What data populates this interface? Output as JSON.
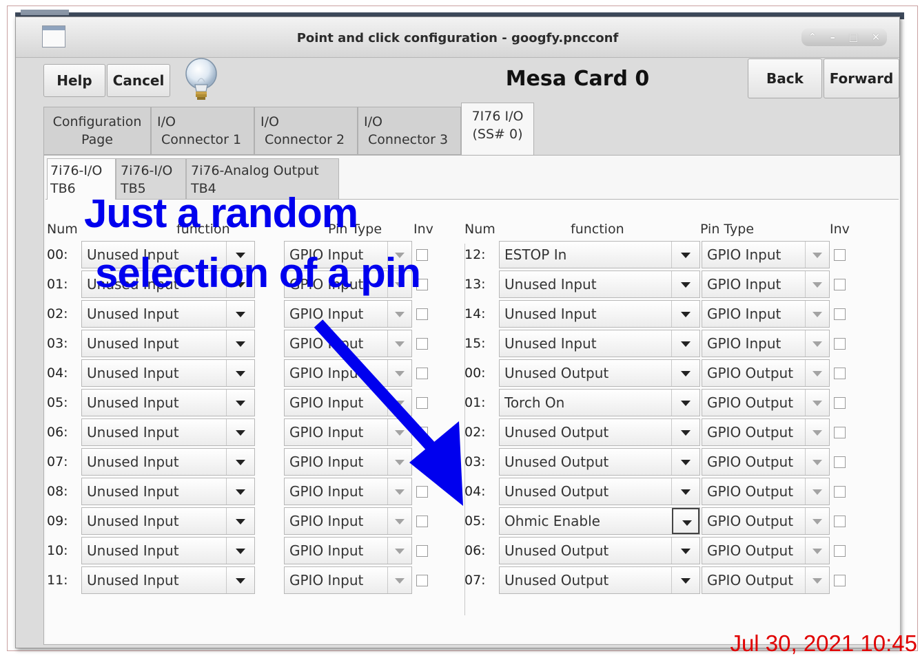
{
  "window": {
    "title": "Point and click configuration - googfy.pncconf"
  },
  "window_controls": [
    "⌃",
    "–",
    "□",
    "✕"
  ],
  "toolbar": {
    "help_label": "Help",
    "cancel_label": "Cancel",
    "back_label": "Back",
    "forward_label": "Forward",
    "heading": "Mesa Card 0"
  },
  "tabs": [
    {
      "line1": "Configuration",
      "line2": "Page"
    },
    {
      "line1": "I/O",
      "line2": "Connector 1"
    },
    {
      "line1": "I/O",
      "line2": "Connector 2"
    },
    {
      "line1": "I/O",
      "line2": "Connector 3"
    },
    {
      "line1": "7I76 I/O",
      "line2": "(SS# 0)"
    }
  ],
  "subtabs": [
    {
      "line1": "7i76-I/O",
      "line2": "TB6"
    },
    {
      "line1": "7i76-I/O",
      "line2": "TB5"
    },
    {
      "line1": "7i76-Analog Output",
      "line2": "TB4"
    }
  ],
  "headers": {
    "num": "Num",
    "function": "function",
    "pin_type": "Pin Type",
    "inv": "Inv"
  },
  "left_pins": [
    {
      "num": "00:",
      "function": "Unused Input",
      "pin_type": "GPIO Input"
    },
    {
      "num": "01:",
      "function": "Unused Input",
      "pin_type": "GPIO Input"
    },
    {
      "num": "02:",
      "function": "Unused Input",
      "pin_type": "GPIO Input"
    },
    {
      "num": "03:",
      "function": "Unused Input",
      "pin_type": "GPIO Input"
    },
    {
      "num": "04:",
      "function": "Unused Input",
      "pin_type": "GPIO Input"
    },
    {
      "num": "05:",
      "function": "Unused Input",
      "pin_type": "GPIO Input"
    },
    {
      "num": "06:",
      "function": "Unused Input",
      "pin_type": "GPIO Input"
    },
    {
      "num": "07:",
      "function": "Unused Input",
      "pin_type": "GPIO Input"
    },
    {
      "num": "08:",
      "function": "Unused Input",
      "pin_type": "GPIO Input"
    },
    {
      "num": "09:",
      "function": "Unused Input",
      "pin_type": "GPIO Input"
    },
    {
      "num": "10:",
      "function": "Unused Input",
      "pin_type": "GPIO Input"
    },
    {
      "num": "11:",
      "function": "Unused Input",
      "pin_type": "GPIO Input"
    }
  ],
  "right_pins": [
    {
      "num": "12:",
      "function": "ESTOP In",
      "pin_type": "GPIO Input"
    },
    {
      "num": "13:",
      "function": "Unused Input",
      "pin_type": "GPIO Input"
    },
    {
      "num": "14:",
      "function": "Unused Input",
      "pin_type": "GPIO Input"
    },
    {
      "num": "15:",
      "function": "Unused Input",
      "pin_type": "GPIO Input"
    },
    {
      "num": "00:",
      "function": "Unused Output",
      "pin_type": "GPIO Output"
    },
    {
      "num": "01:",
      "function": "Torch On",
      "pin_type": "GPIO Output"
    },
    {
      "num": "02:",
      "function": "Unused Output",
      "pin_type": "GPIO Output"
    },
    {
      "num": "03:",
      "function": "Unused Output",
      "pin_type": "GPIO Output"
    },
    {
      "num": "04:",
      "function": "Unused Output",
      "pin_type": "GPIO Output"
    },
    {
      "num": "05:",
      "function": "Ohmic Enable",
      "pin_type": "GPIO Output"
    },
    {
      "num": "06:",
      "function": "Unused Output",
      "pin_type": "GPIO Output"
    },
    {
      "num": "07:",
      "function": "Unused Output",
      "pin_type": "GPIO Output"
    }
  ],
  "annotation": {
    "line1": "Just a random",
    "line2": "selection of a pin",
    "color": "#0000EE"
  },
  "timestamp": {
    "text": "Jul 30, 2021 10:45",
    "color": "#E00000"
  }
}
